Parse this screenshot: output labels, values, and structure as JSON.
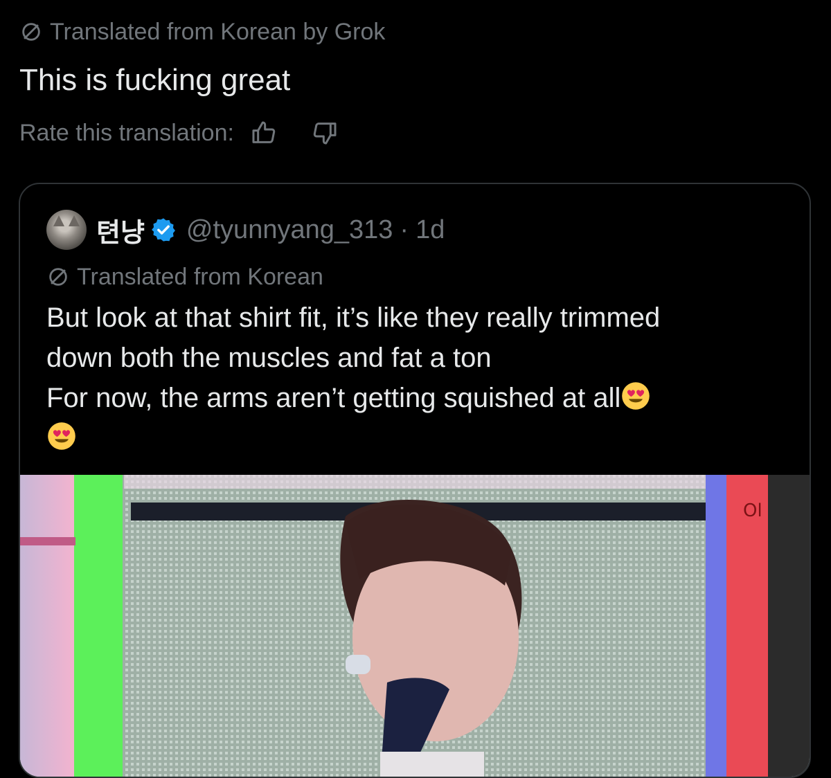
{
  "translation": {
    "label": "Translated from Korean by Grok",
    "text": "This is fucking great",
    "rate_label": "Rate this translation:",
    "icons": [
      "no-symbol-icon",
      "thumbs-up-icon",
      "thumbs-down-icon"
    ]
  },
  "quote": {
    "display_name": "텬냥",
    "handle": "@tyunnyang_313",
    "separator": "·",
    "time": "1d",
    "translated_label": "Translated from Korean",
    "lines": [
      "But look at that shirt fit, it’s like they really trimmed",
      "down both the muscles and fat a ton",
      "For now, the arms aren’t getting squished at all"
    ],
    "emoji_name": "heart-eyes-emoji",
    "verified_color": "#1d9bf0"
  },
  "media": {
    "sign_text": "Ol"
  },
  "colors": {
    "background": "#000000",
    "text": "#e7e9ea",
    "muted": "#71767b",
    "border": "#2f3336"
  }
}
